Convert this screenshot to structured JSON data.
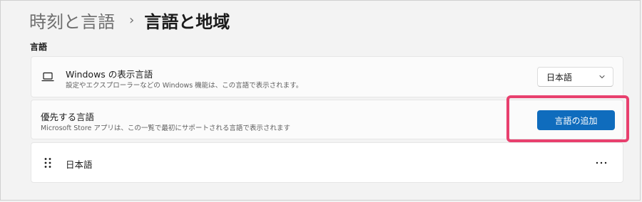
{
  "breadcrumb": {
    "parent": "時刻と言語",
    "separator": "›",
    "current": "言語と地域"
  },
  "section": {
    "label": "言語"
  },
  "display_language": {
    "icon": "laptop-icon",
    "title": "Windows の表示言語",
    "subtitle": "設定やエクスプローラーなどの Windows 機能は、この言語で表示されます。",
    "selected": "日本語"
  },
  "preferred_languages": {
    "title": "優先する言語",
    "subtitle": "Microsoft Store アプリは、この一覧で最初にサポートされる言語で表示されます",
    "add_button": "言語の追加"
  },
  "language_list": {
    "items": [
      {
        "name": "日本語",
        "handle_icon": "drag-handle-icon",
        "menu_icon": "more-icon"
      }
    ]
  },
  "colors": {
    "accent": "#0f6cbd",
    "highlight": "#e8406e",
    "background": "#f3f3f3",
    "card": "#fbfbfb"
  }
}
